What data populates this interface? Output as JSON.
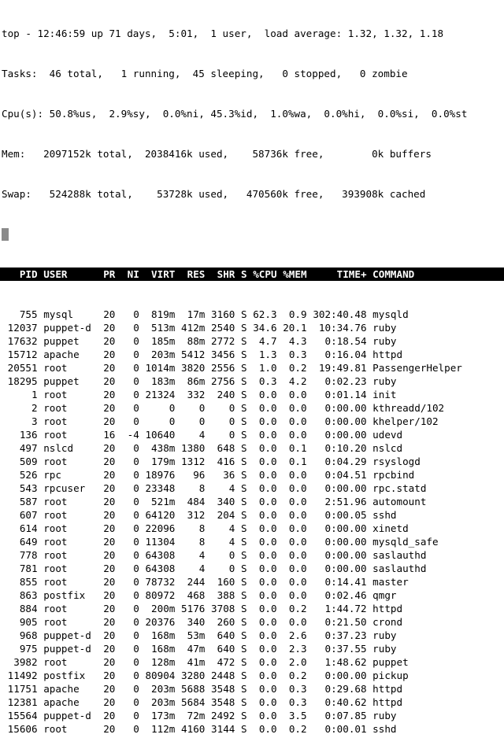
{
  "summary": {
    "line1": "top - 12:46:59 up 71 days,  5:01,  1 user,  load average: 1.32, 1.32, 1.18",
    "line2": "Tasks:  46 total,   1 running,  45 sleeping,   0 stopped,   0 zombie",
    "line3": "Cpu(s): 50.8%us,  2.9%sy,  0.0%ni, 45.3%id,  1.0%wa,  0.0%hi,  0.0%si,  0.0%st",
    "line4": "Mem:   2097152k total,  2038416k used,    58736k free,        0k buffers",
    "line5": "Swap:   524288k total,    53728k used,   470560k free,   393908k cached"
  },
  "columns": {
    "pid": "PID",
    "user": "USER",
    "pr": "PR",
    "ni": "NI",
    "virt": "VIRT",
    "res": "RES",
    "shr": "SHR",
    "s": "S",
    "cpu": "%CPU",
    "mem": "%MEM",
    "time": "TIME+",
    "command": "COMMAND"
  },
  "processes": [
    {
      "pid": "755",
      "user": "mysql",
      "pr": "20",
      "ni": "0",
      "virt": "819m",
      "res": "17m",
      "shr": "3160",
      "s": "S",
      "cpu": "62.3",
      "mem": "0.9",
      "time": "302:40.48",
      "command": "mysqld"
    },
    {
      "pid": "12037",
      "user": "puppet-d",
      "pr": "20",
      "ni": "0",
      "virt": "513m",
      "res": "412m",
      "shr": "2540",
      "s": "S",
      "cpu": "34.6",
      "mem": "20.1",
      "time": "10:34.76",
      "command": "ruby"
    },
    {
      "pid": "17632",
      "user": "puppet",
      "pr": "20",
      "ni": "0",
      "virt": "185m",
      "res": "88m",
      "shr": "2772",
      "s": "S",
      "cpu": "4.7",
      "mem": "4.3",
      "time": "0:18.54",
      "command": "ruby"
    },
    {
      "pid": "15712",
      "user": "apache",
      "pr": "20",
      "ni": "0",
      "virt": "203m",
      "res": "5412",
      "shr": "3456",
      "s": "S",
      "cpu": "1.3",
      "mem": "0.3",
      "time": "0:16.04",
      "command": "httpd"
    },
    {
      "pid": "20551",
      "user": "root",
      "pr": "20",
      "ni": "0",
      "virt": "1014m",
      "res": "3820",
      "shr": "2556",
      "s": "S",
      "cpu": "1.0",
      "mem": "0.2",
      "time": "19:49.81",
      "command": "PassengerHelper"
    },
    {
      "pid": "18295",
      "user": "puppet",
      "pr": "20",
      "ni": "0",
      "virt": "183m",
      "res": "86m",
      "shr": "2756",
      "s": "S",
      "cpu": "0.3",
      "mem": "4.2",
      "time": "0:02.23",
      "command": "ruby"
    },
    {
      "pid": "1",
      "user": "root",
      "pr": "20",
      "ni": "0",
      "virt": "21324",
      "res": "332",
      "shr": "240",
      "s": "S",
      "cpu": "0.0",
      "mem": "0.0",
      "time": "0:01.14",
      "command": "init"
    },
    {
      "pid": "2",
      "user": "root",
      "pr": "20",
      "ni": "0",
      "virt": "0",
      "res": "0",
      "shr": "0",
      "s": "S",
      "cpu": "0.0",
      "mem": "0.0",
      "time": "0:00.00",
      "command": "kthreadd/102"
    },
    {
      "pid": "3",
      "user": "root",
      "pr": "20",
      "ni": "0",
      "virt": "0",
      "res": "0",
      "shr": "0",
      "s": "S",
      "cpu": "0.0",
      "mem": "0.0",
      "time": "0:00.00",
      "command": "khelper/102"
    },
    {
      "pid": "136",
      "user": "root",
      "pr": "16",
      "ni": "-4",
      "virt": "10640",
      "res": "4",
      "shr": "0",
      "s": "S",
      "cpu": "0.0",
      "mem": "0.0",
      "time": "0:00.00",
      "command": "udevd"
    },
    {
      "pid": "497",
      "user": "nslcd",
      "pr": "20",
      "ni": "0",
      "virt": "438m",
      "res": "1380",
      "shr": "648",
      "s": "S",
      "cpu": "0.0",
      "mem": "0.1",
      "time": "0:10.20",
      "command": "nslcd"
    },
    {
      "pid": "509",
      "user": "root",
      "pr": "20",
      "ni": "0",
      "virt": "179m",
      "res": "1312",
      "shr": "416",
      "s": "S",
      "cpu": "0.0",
      "mem": "0.1",
      "time": "0:04.29",
      "command": "rsyslogd"
    },
    {
      "pid": "526",
      "user": "rpc",
      "pr": "20",
      "ni": "0",
      "virt": "18976",
      "res": "96",
      "shr": "36",
      "s": "S",
      "cpu": "0.0",
      "mem": "0.0",
      "time": "0:04.51",
      "command": "rpcbind"
    },
    {
      "pid": "543",
      "user": "rpcuser",
      "pr": "20",
      "ni": "0",
      "virt": "23348",
      "res": "8",
      "shr": "4",
      "s": "S",
      "cpu": "0.0",
      "mem": "0.0",
      "time": "0:00.00",
      "command": "rpc.statd"
    },
    {
      "pid": "587",
      "user": "root",
      "pr": "20",
      "ni": "0",
      "virt": "521m",
      "res": "484",
      "shr": "340",
      "s": "S",
      "cpu": "0.0",
      "mem": "0.0",
      "time": "2:51.96",
      "command": "automount"
    },
    {
      "pid": "607",
      "user": "root",
      "pr": "20",
      "ni": "0",
      "virt": "64120",
      "res": "312",
      "shr": "204",
      "s": "S",
      "cpu": "0.0",
      "mem": "0.0",
      "time": "0:00.05",
      "command": "sshd"
    },
    {
      "pid": "614",
      "user": "root",
      "pr": "20",
      "ni": "0",
      "virt": "22096",
      "res": "8",
      "shr": "4",
      "s": "S",
      "cpu": "0.0",
      "mem": "0.0",
      "time": "0:00.00",
      "command": "xinetd"
    },
    {
      "pid": "649",
      "user": "root",
      "pr": "20",
      "ni": "0",
      "virt": "11304",
      "res": "8",
      "shr": "4",
      "s": "S",
      "cpu": "0.0",
      "mem": "0.0",
      "time": "0:00.00",
      "command": "mysqld_safe"
    },
    {
      "pid": "778",
      "user": "root",
      "pr": "20",
      "ni": "0",
      "virt": "64308",
      "res": "4",
      "shr": "0",
      "s": "S",
      "cpu": "0.0",
      "mem": "0.0",
      "time": "0:00.00",
      "command": "saslauthd"
    },
    {
      "pid": "781",
      "user": "root",
      "pr": "20",
      "ni": "0",
      "virt": "64308",
      "res": "4",
      "shr": "0",
      "s": "S",
      "cpu": "0.0",
      "mem": "0.0",
      "time": "0:00.00",
      "command": "saslauthd"
    },
    {
      "pid": "855",
      "user": "root",
      "pr": "20",
      "ni": "0",
      "virt": "78732",
      "res": "244",
      "shr": "160",
      "s": "S",
      "cpu": "0.0",
      "mem": "0.0",
      "time": "0:14.41",
      "command": "master"
    },
    {
      "pid": "863",
      "user": "postfix",
      "pr": "20",
      "ni": "0",
      "virt": "80972",
      "res": "468",
      "shr": "388",
      "s": "S",
      "cpu": "0.0",
      "mem": "0.0",
      "time": "0:02.46",
      "command": "qmgr"
    },
    {
      "pid": "884",
      "user": "root",
      "pr": "20",
      "ni": "0",
      "virt": "200m",
      "res": "5176",
      "shr": "3708",
      "s": "S",
      "cpu": "0.0",
      "mem": "0.2",
      "time": "1:44.72",
      "command": "httpd"
    },
    {
      "pid": "905",
      "user": "root",
      "pr": "20",
      "ni": "0",
      "virt": "20376",
      "res": "340",
      "shr": "260",
      "s": "S",
      "cpu": "0.0",
      "mem": "0.0",
      "time": "0:21.50",
      "command": "crond"
    },
    {
      "pid": "968",
      "user": "puppet-d",
      "pr": "20",
      "ni": "0",
      "virt": "168m",
      "res": "53m",
      "shr": "640",
      "s": "S",
      "cpu": "0.0",
      "mem": "2.6",
      "time": "0:37.23",
      "command": "ruby"
    },
    {
      "pid": "975",
      "user": "puppet-d",
      "pr": "20",
      "ni": "0",
      "virt": "168m",
      "res": "47m",
      "shr": "640",
      "s": "S",
      "cpu": "0.0",
      "mem": "2.3",
      "time": "0:37.55",
      "command": "ruby"
    },
    {
      "pid": "3982",
      "user": "root",
      "pr": "20",
      "ni": "0",
      "virt": "128m",
      "res": "41m",
      "shr": "472",
      "s": "S",
      "cpu": "0.0",
      "mem": "2.0",
      "time": "1:48.62",
      "command": "puppet"
    },
    {
      "pid": "11492",
      "user": "postfix",
      "pr": "20",
      "ni": "0",
      "virt": "80904",
      "res": "3280",
      "shr": "2448",
      "s": "S",
      "cpu": "0.0",
      "mem": "0.2",
      "time": "0:00.00",
      "command": "pickup"
    },
    {
      "pid": "11751",
      "user": "apache",
      "pr": "20",
      "ni": "0",
      "virt": "203m",
      "res": "5688",
      "shr": "3548",
      "s": "S",
      "cpu": "0.0",
      "mem": "0.3",
      "time": "0:29.68",
      "command": "httpd"
    },
    {
      "pid": "12381",
      "user": "apache",
      "pr": "20",
      "ni": "0",
      "virt": "203m",
      "res": "5684",
      "shr": "3548",
      "s": "S",
      "cpu": "0.0",
      "mem": "0.3",
      "time": "0:40.62",
      "command": "httpd"
    },
    {
      "pid": "15564",
      "user": "puppet-d",
      "pr": "20",
      "ni": "0",
      "virt": "173m",
      "res": "72m",
      "shr": "2492",
      "s": "S",
      "cpu": "0.0",
      "mem": "3.5",
      "time": "0:07.85",
      "command": "ruby"
    },
    {
      "pid": "15606",
      "user": "root",
      "pr": "20",
      "ni": "0",
      "virt": "112m",
      "res": "4160",
      "shr": "3144",
      "s": "S",
      "cpu": "0.0",
      "mem": "0.2",
      "time": "0:00.01",
      "command": "sshd"
    }
  ]
}
